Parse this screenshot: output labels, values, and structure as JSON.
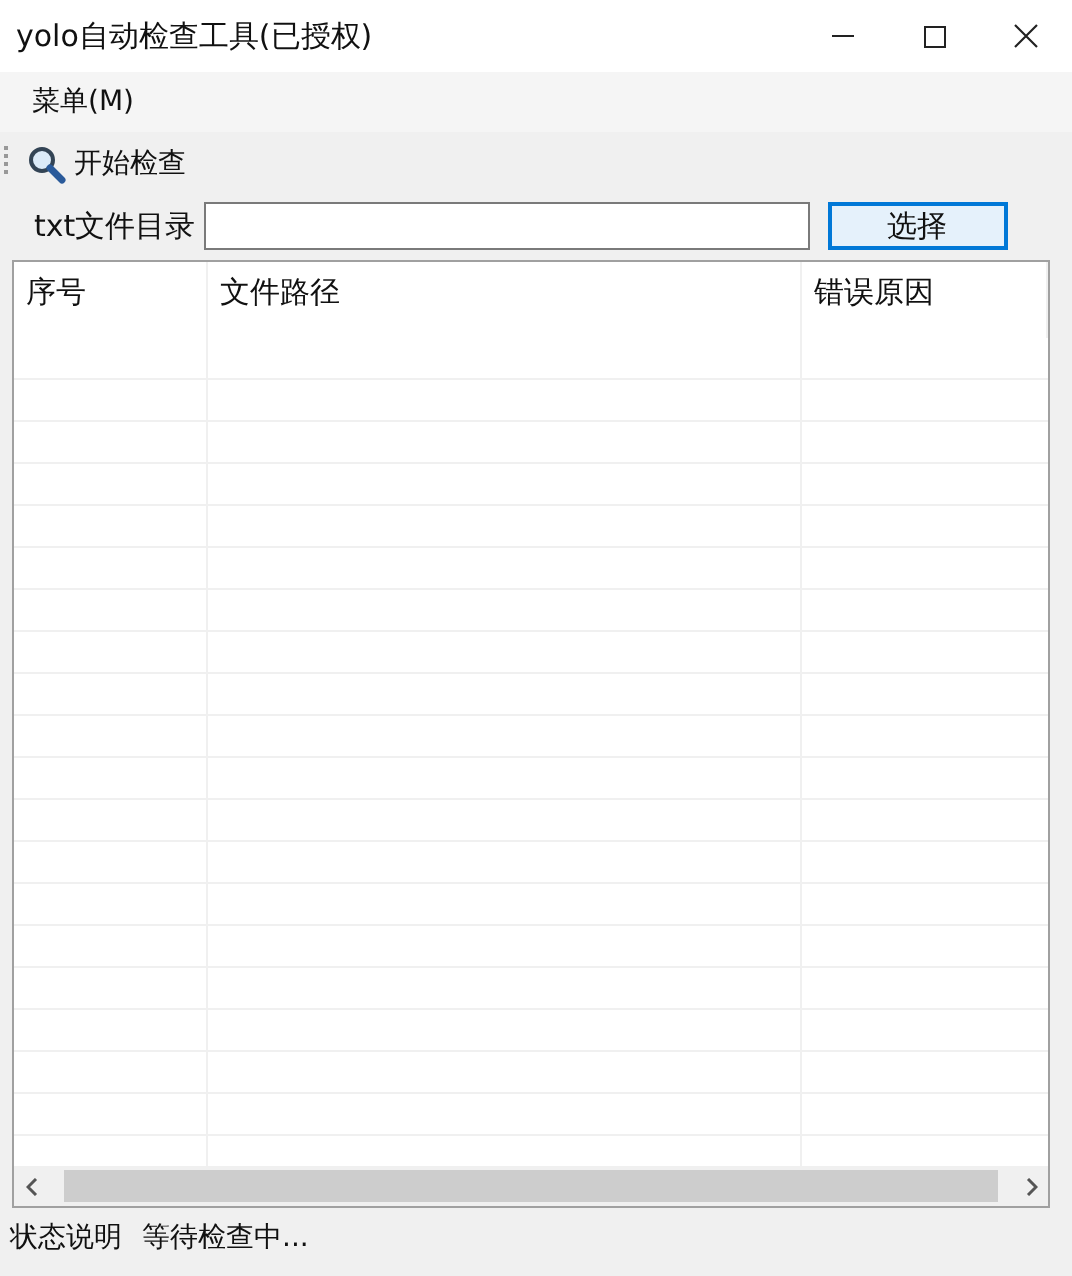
{
  "window": {
    "title": "yolo自动检查工具(已授权)"
  },
  "menu": [
    {
      "label": "菜单(M)"
    }
  ],
  "toolbar": [
    {
      "label": "开始检查"
    }
  ],
  "path_row": {
    "label": "txt文件目录",
    "button": "选择"
  },
  "table": {
    "columns": [
      "序号",
      "文件路径",
      "错误原因"
    ]
  },
  "status_bar": {
    "label": "状态说明",
    "message": "等待检查中..."
  }
}
